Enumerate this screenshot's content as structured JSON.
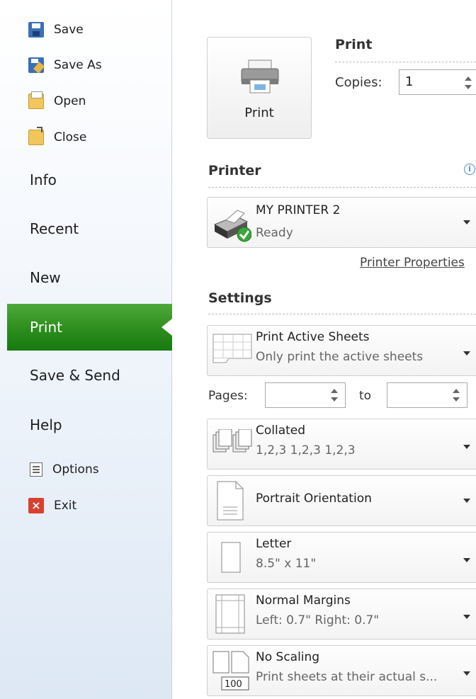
{
  "sidebar": {
    "save": "Save",
    "save_as": "Save As",
    "open": "Open",
    "close": "Close",
    "info": "Info",
    "recent": "Recent",
    "new": "New",
    "print": "Print",
    "save_send": "Save & Send",
    "help": "Help",
    "options": "Options",
    "exit": "Exit",
    "active": "Print",
    "active_color": "#2f8f1f"
  },
  "print_section": {
    "title": "Print",
    "button_label": "Print",
    "copies_label": "Copies:",
    "copies_value": "1"
  },
  "printer_section": {
    "title": "Printer",
    "info_icon": "i",
    "name": "MY PRINTER 2",
    "status": "Ready",
    "properties_link": "Printer Properties"
  },
  "settings_section": {
    "title": "Settings",
    "active_sheets": {
      "title": "Print Active Sheets",
      "subtitle": "Only print the active sheets"
    },
    "pages_label": "Pages:",
    "pages_from": "",
    "pages_to_label": "to",
    "pages_to": "",
    "collated": {
      "title": "Collated",
      "subtitle": "1,2,3   1,2,3   1,2,3"
    },
    "orientation": {
      "title": "Portrait Orientation"
    },
    "paper": {
      "title": "Letter",
      "subtitle": "8.5\" x 11\""
    },
    "margins": {
      "title": "Normal Margins",
      "subtitle": "Left: 0.7\"   Right: 0.7\""
    },
    "scaling": {
      "title": "No Scaling",
      "subtitle": "Print sheets at their actual s...",
      "icon_text": "100"
    }
  }
}
